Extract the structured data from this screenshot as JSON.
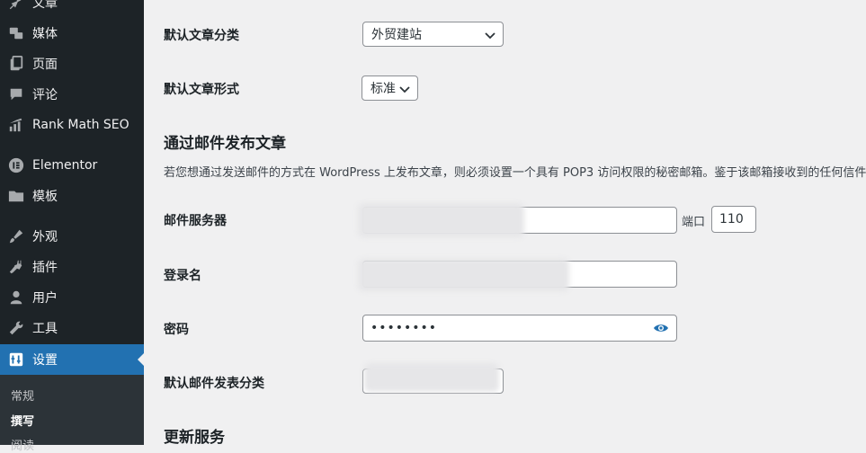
{
  "sidebar": {
    "items": [
      {
        "label": "文章",
        "icon": "pin-icon"
      },
      {
        "label": "媒体",
        "icon": "media-icon"
      },
      {
        "label": "页面",
        "icon": "pages-icon"
      },
      {
        "label": "评论",
        "icon": "comment-icon"
      },
      {
        "label": "Rank Math SEO",
        "icon": "rank-math-icon"
      },
      {
        "label": "Elementor",
        "icon": "elementor-icon"
      },
      {
        "label": "模板",
        "icon": "folder-icon"
      },
      {
        "label": "外观",
        "icon": "brush-icon"
      },
      {
        "label": "插件",
        "icon": "plugin-icon"
      },
      {
        "label": "用户",
        "icon": "user-icon"
      },
      {
        "label": "工具",
        "icon": "wrench-icon"
      },
      {
        "label": "设置",
        "icon": "settings-icon"
      }
    ],
    "submenu": [
      "常规",
      "撰写",
      "阅读"
    ]
  },
  "form": {
    "default_category_label": "默认文章分类",
    "default_category_value": "外贸建站",
    "default_format_label": "默认文章形式",
    "default_format_value": "标准",
    "mail_heading": "通过邮件发布文章",
    "mail_desc": "若您想通过发送邮件的方式在 WordPress 上发布文章，则必须设置一个具有 POP3 访问权限的秘密邮箱。鉴于该邮箱接收到的任何信件都",
    "mail_server_label": "邮件服务器",
    "port_label": "端口",
    "port_value": "110",
    "login_label": "登录名",
    "password_label": "密码",
    "password_value": "••••••••",
    "mail_category_label": "默认邮件发表分类",
    "update_heading": "更新服务"
  },
  "colors": {
    "sidebar_bg": "#1d2327",
    "active_bg": "#2271b1",
    "accent": "#2271b1"
  }
}
